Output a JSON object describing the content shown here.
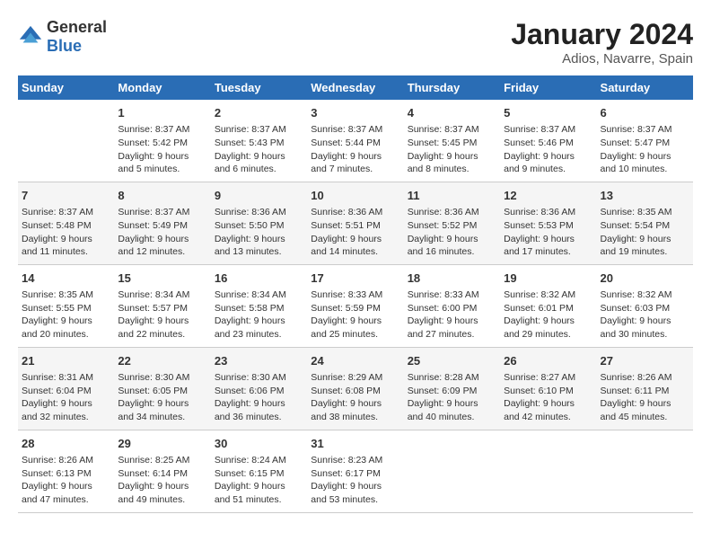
{
  "logo": {
    "general": "General",
    "blue": "Blue"
  },
  "header": {
    "title": "January 2024",
    "subtitle": "Adios, Navarre, Spain"
  },
  "weekdays": [
    "Sunday",
    "Monday",
    "Tuesday",
    "Wednesday",
    "Thursday",
    "Friday",
    "Saturday"
  ],
  "weeks": [
    [
      {
        "day": "",
        "info": ""
      },
      {
        "day": "1",
        "info": "Sunrise: 8:37 AM\nSunset: 5:42 PM\nDaylight: 9 hours\nand 5 minutes."
      },
      {
        "day": "2",
        "info": "Sunrise: 8:37 AM\nSunset: 5:43 PM\nDaylight: 9 hours\nand 6 minutes."
      },
      {
        "day": "3",
        "info": "Sunrise: 8:37 AM\nSunset: 5:44 PM\nDaylight: 9 hours\nand 7 minutes."
      },
      {
        "day": "4",
        "info": "Sunrise: 8:37 AM\nSunset: 5:45 PM\nDaylight: 9 hours\nand 8 minutes."
      },
      {
        "day": "5",
        "info": "Sunrise: 8:37 AM\nSunset: 5:46 PM\nDaylight: 9 hours\nand 9 minutes."
      },
      {
        "day": "6",
        "info": "Sunrise: 8:37 AM\nSunset: 5:47 PM\nDaylight: 9 hours\nand 10 minutes."
      }
    ],
    [
      {
        "day": "7",
        "info": "Sunrise: 8:37 AM\nSunset: 5:48 PM\nDaylight: 9 hours\nand 11 minutes."
      },
      {
        "day": "8",
        "info": "Sunrise: 8:37 AM\nSunset: 5:49 PM\nDaylight: 9 hours\nand 12 minutes."
      },
      {
        "day": "9",
        "info": "Sunrise: 8:36 AM\nSunset: 5:50 PM\nDaylight: 9 hours\nand 13 minutes."
      },
      {
        "day": "10",
        "info": "Sunrise: 8:36 AM\nSunset: 5:51 PM\nDaylight: 9 hours\nand 14 minutes."
      },
      {
        "day": "11",
        "info": "Sunrise: 8:36 AM\nSunset: 5:52 PM\nDaylight: 9 hours\nand 16 minutes."
      },
      {
        "day": "12",
        "info": "Sunrise: 8:36 AM\nSunset: 5:53 PM\nDaylight: 9 hours\nand 17 minutes."
      },
      {
        "day": "13",
        "info": "Sunrise: 8:35 AM\nSunset: 5:54 PM\nDaylight: 9 hours\nand 19 minutes."
      }
    ],
    [
      {
        "day": "14",
        "info": "Sunrise: 8:35 AM\nSunset: 5:55 PM\nDaylight: 9 hours\nand 20 minutes."
      },
      {
        "day": "15",
        "info": "Sunrise: 8:34 AM\nSunset: 5:57 PM\nDaylight: 9 hours\nand 22 minutes."
      },
      {
        "day": "16",
        "info": "Sunrise: 8:34 AM\nSunset: 5:58 PM\nDaylight: 9 hours\nand 23 minutes."
      },
      {
        "day": "17",
        "info": "Sunrise: 8:33 AM\nSunset: 5:59 PM\nDaylight: 9 hours\nand 25 minutes."
      },
      {
        "day": "18",
        "info": "Sunrise: 8:33 AM\nSunset: 6:00 PM\nDaylight: 9 hours\nand 27 minutes."
      },
      {
        "day": "19",
        "info": "Sunrise: 8:32 AM\nSunset: 6:01 PM\nDaylight: 9 hours\nand 29 minutes."
      },
      {
        "day": "20",
        "info": "Sunrise: 8:32 AM\nSunset: 6:03 PM\nDaylight: 9 hours\nand 30 minutes."
      }
    ],
    [
      {
        "day": "21",
        "info": "Sunrise: 8:31 AM\nSunset: 6:04 PM\nDaylight: 9 hours\nand 32 minutes."
      },
      {
        "day": "22",
        "info": "Sunrise: 8:30 AM\nSunset: 6:05 PM\nDaylight: 9 hours\nand 34 minutes."
      },
      {
        "day": "23",
        "info": "Sunrise: 8:30 AM\nSunset: 6:06 PM\nDaylight: 9 hours\nand 36 minutes."
      },
      {
        "day": "24",
        "info": "Sunrise: 8:29 AM\nSunset: 6:08 PM\nDaylight: 9 hours\nand 38 minutes."
      },
      {
        "day": "25",
        "info": "Sunrise: 8:28 AM\nSunset: 6:09 PM\nDaylight: 9 hours\nand 40 minutes."
      },
      {
        "day": "26",
        "info": "Sunrise: 8:27 AM\nSunset: 6:10 PM\nDaylight: 9 hours\nand 42 minutes."
      },
      {
        "day": "27",
        "info": "Sunrise: 8:26 AM\nSunset: 6:11 PM\nDaylight: 9 hours\nand 45 minutes."
      }
    ],
    [
      {
        "day": "28",
        "info": "Sunrise: 8:26 AM\nSunset: 6:13 PM\nDaylight: 9 hours\nand 47 minutes."
      },
      {
        "day": "29",
        "info": "Sunrise: 8:25 AM\nSunset: 6:14 PM\nDaylight: 9 hours\nand 49 minutes."
      },
      {
        "day": "30",
        "info": "Sunrise: 8:24 AM\nSunset: 6:15 PM\nDaylight: 9 hours\nand 51 minutes."
      },
      {
        "day": "31",
        "info": "Sunrise: 8:23 AM\nSunset: 6:17 PM\nDaylight: 9 hours\nand 53 minutes."
      },
      {
        "day": "",
        "info": ""
      },
      {
        "day": "",
        "info": ""
      },
      {
        "day": "",
        "info": ""
      }
    ]
  ]
}
